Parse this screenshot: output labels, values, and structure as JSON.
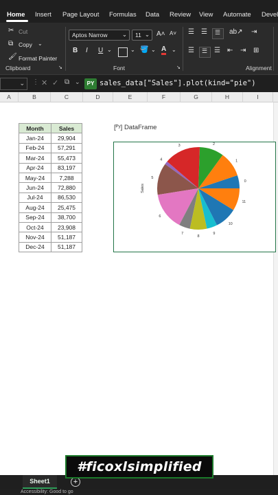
{
  "ribbon_tabs": [
    "Home",
    "Insert",
    "Page Layout",
    "Formulas",
    "Data",
    "Review",
    "View",
    "Automate",
    "Devel"
  ],
  "clipboard": {
    "cut": "Cut",
    "copy": "Copy",
    "format_painter": "Format Painter",
    "group": "Clipboard"
  },
  "font": {
    "name": "Aptos Narrow",
    "size": "11",
    "group": "Font",
    "bold": "B",
    "italic": "I",
    "underline": "U"
  },
  "alignment": {
    "group": "Alignment"
  },
  "formula_bar": {
    "badge": "PY",
    "formula": "sales_data[\"Sales\"].plot(kind=\"pie\")"
  },
  "columns": [
    "A",
    "B",
    "C",
    "D",
    "E",
    "F",
    "G",
    "H",
    "I"
  ],
  "table": {
    "headers": [
      "Month",
      "Sales"
    ],
    "rows": [
      {
        "month": "Jan-24",
        "sales": "29,904"
      },
      {
        "month": "Feb-24",
        "sales": "57,291"
      },
      {
        "month": "Mar-24",
        "sales": "55,473"
      },
      {
        "month": "Apr-24",
        "sales": "83,197"
      },
      {
        "month": "May-24",
        "sales": "7,288"
      },
      {
        "month": "Jun-24",
        "sales": "72,880"
      },
      {
        "month": "Jul-24",
        "sales": "86,530"
      },
      {
        "month": "Aug-24",
        "sales": "25,475"
      },
      {
        "month": "Sep-24",
        "sales": "38,700"
      },
      {
        "month": "Oct-24",
        "sales": "23,908"
      },
      {
        "month": "Nov-24",
        "sales": "51,187"
      },
      {
        "month": "Dec-24",
        "sales": "51,187"
      }
    ]
  },
  "dataframe_label": "[ᴾʸ] DataFrame",
  "chart_data": {
    "type": "pie",
    "ylabel": "Sales",
    "categories": [
      "0",
      "1",
      "2",
      "3",
      "4",
      "5",
      "6",
      "7",
      "8",
      "9",
      "10",
      "11"
    ],
    "values": [
      29904,
      57291,
      55473,
      83197,
      7288,
      72880,
      86530,
      25475,
      38700,
      23908,
      51187,
      51187
    ],
    "colors": [
      "#1f77b4",
      "#ff7f0e",
      "#2ca02c",
      "#d62728",
      "#9467bd",
      "#8c564b",
      "#e377c2",
      "#7f7f7f",
      "#bcbd22",
      "#17becf",
      "#1f77b4",
      "#ff7f0e"
    ]
  },
  "sheet_tab": "Sheet1",
  "add_sheet": "+",
  "status": "Accessibility: Good to go",
  "watermark": "#ficoxlsimplified"
}
